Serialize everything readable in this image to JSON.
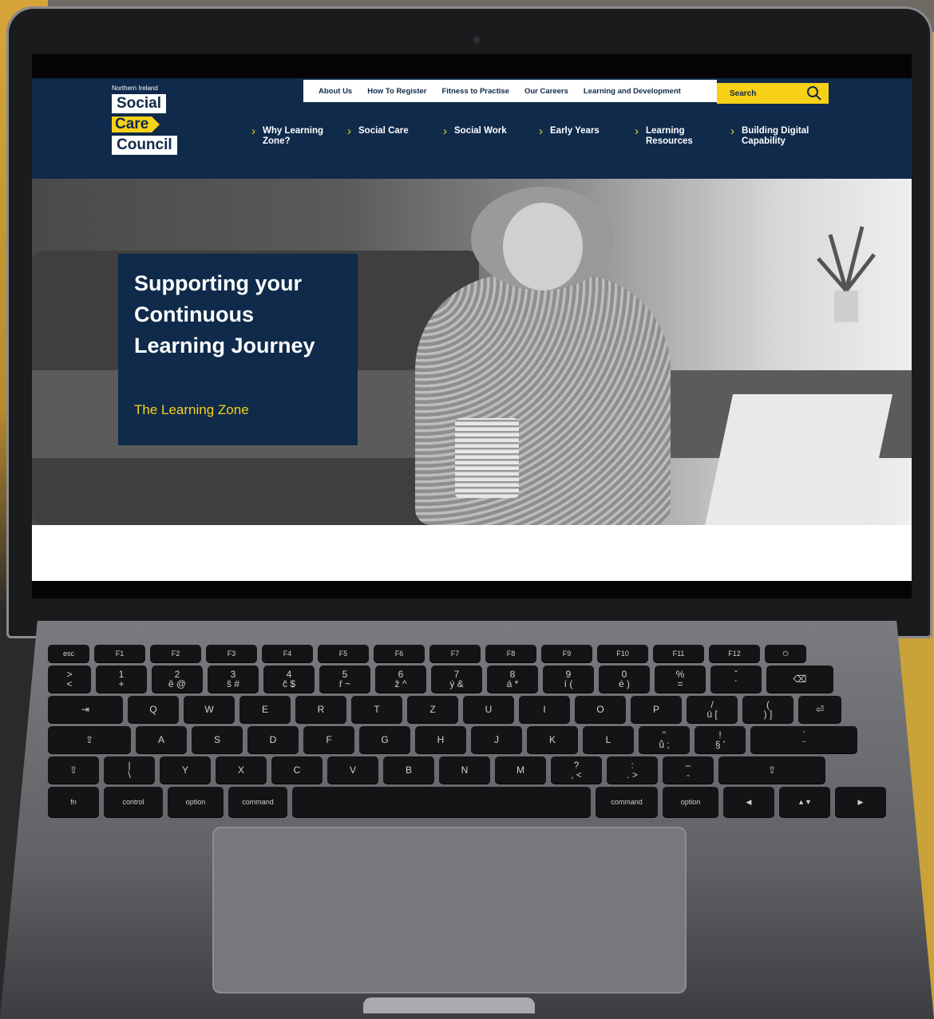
{
  "logo": {
    "caption": "Northern Ireland",
    "line1": "Social",
    "line2": "Care",
    "line3": "Council"
  },
  "topbar": {
    "links": [
      "About Us",
      "How To Register",
      "Fitness to Practise",
      "Our Careers",
      "Learning and Development"
    ],
    "search_label": "Search"
  },
  "nav": {
    "items": [
      "Why Learning Zone?",
      "Social Care",
      "Social Work",
      "Early Years",
      "Learning Resources",
      "Building Digital Capability"
    ]
  },
  "hero": {
    "title": "Supporting your Continuous Learning Journey",
    "subtitle": "The Learning Zone"
  },
  "keyboard": {
    "row1": [
      "esc",
      "F1",
      "F2",
      "F3",
      "F4",
      "F5",
      "F6",
      "F7",
      "F8",
      "F9",
      "F10",
      "F11",
      "F12",
      "⏻"
    ],
    "row2": [
      ">\n<",
      "1\n+",
      "2\ně @",
      "3\nš #",
      "4\nč $",
      "5\nř ~",
      "6\nž ^",
      "7\ný &",
      "8\ná *",
      "9\ní (",
      "0\né )",
      "%\n=",
      "ˇ\n´",
      "⌫"
    ],
    "row3": [
      "⇥",
      "Q",
      "W",
      "E",
      "R",
      "T",
      "Z",
      "U",
      "I",
      "O",
      "P",
      "/\nú [",
      "(\n) ]",
      "⏎"
    ],
    "row4": [
      "⇪",
      "A",
      "S",
      "D",
      "F",
      "G",
      "H",
      "J",
      "K",
      "L",
      "\"\nů ;",
      "!\n§ '",
      "`\n¨"
    ],
    "row5": [
      "⇧",
      "|\n\\",
      "Y",
      "X",
      "C",
      "V",
      "B",
      "N",
      "M",
      "?\n, <",
      ":\n. >",
      "–\n-",
      "⇧"
    ],
    "row6": [
      "fn",
      "control",
      "option",
      "command",
      "",
      "command",
      "option",
      "◀",
      "▲▼",
      "▶"
    ]
  },
  "colors": {
    "brand_navy": "#0f2a4a",
    "brand_yellow": "#f7d117"
  }
}
